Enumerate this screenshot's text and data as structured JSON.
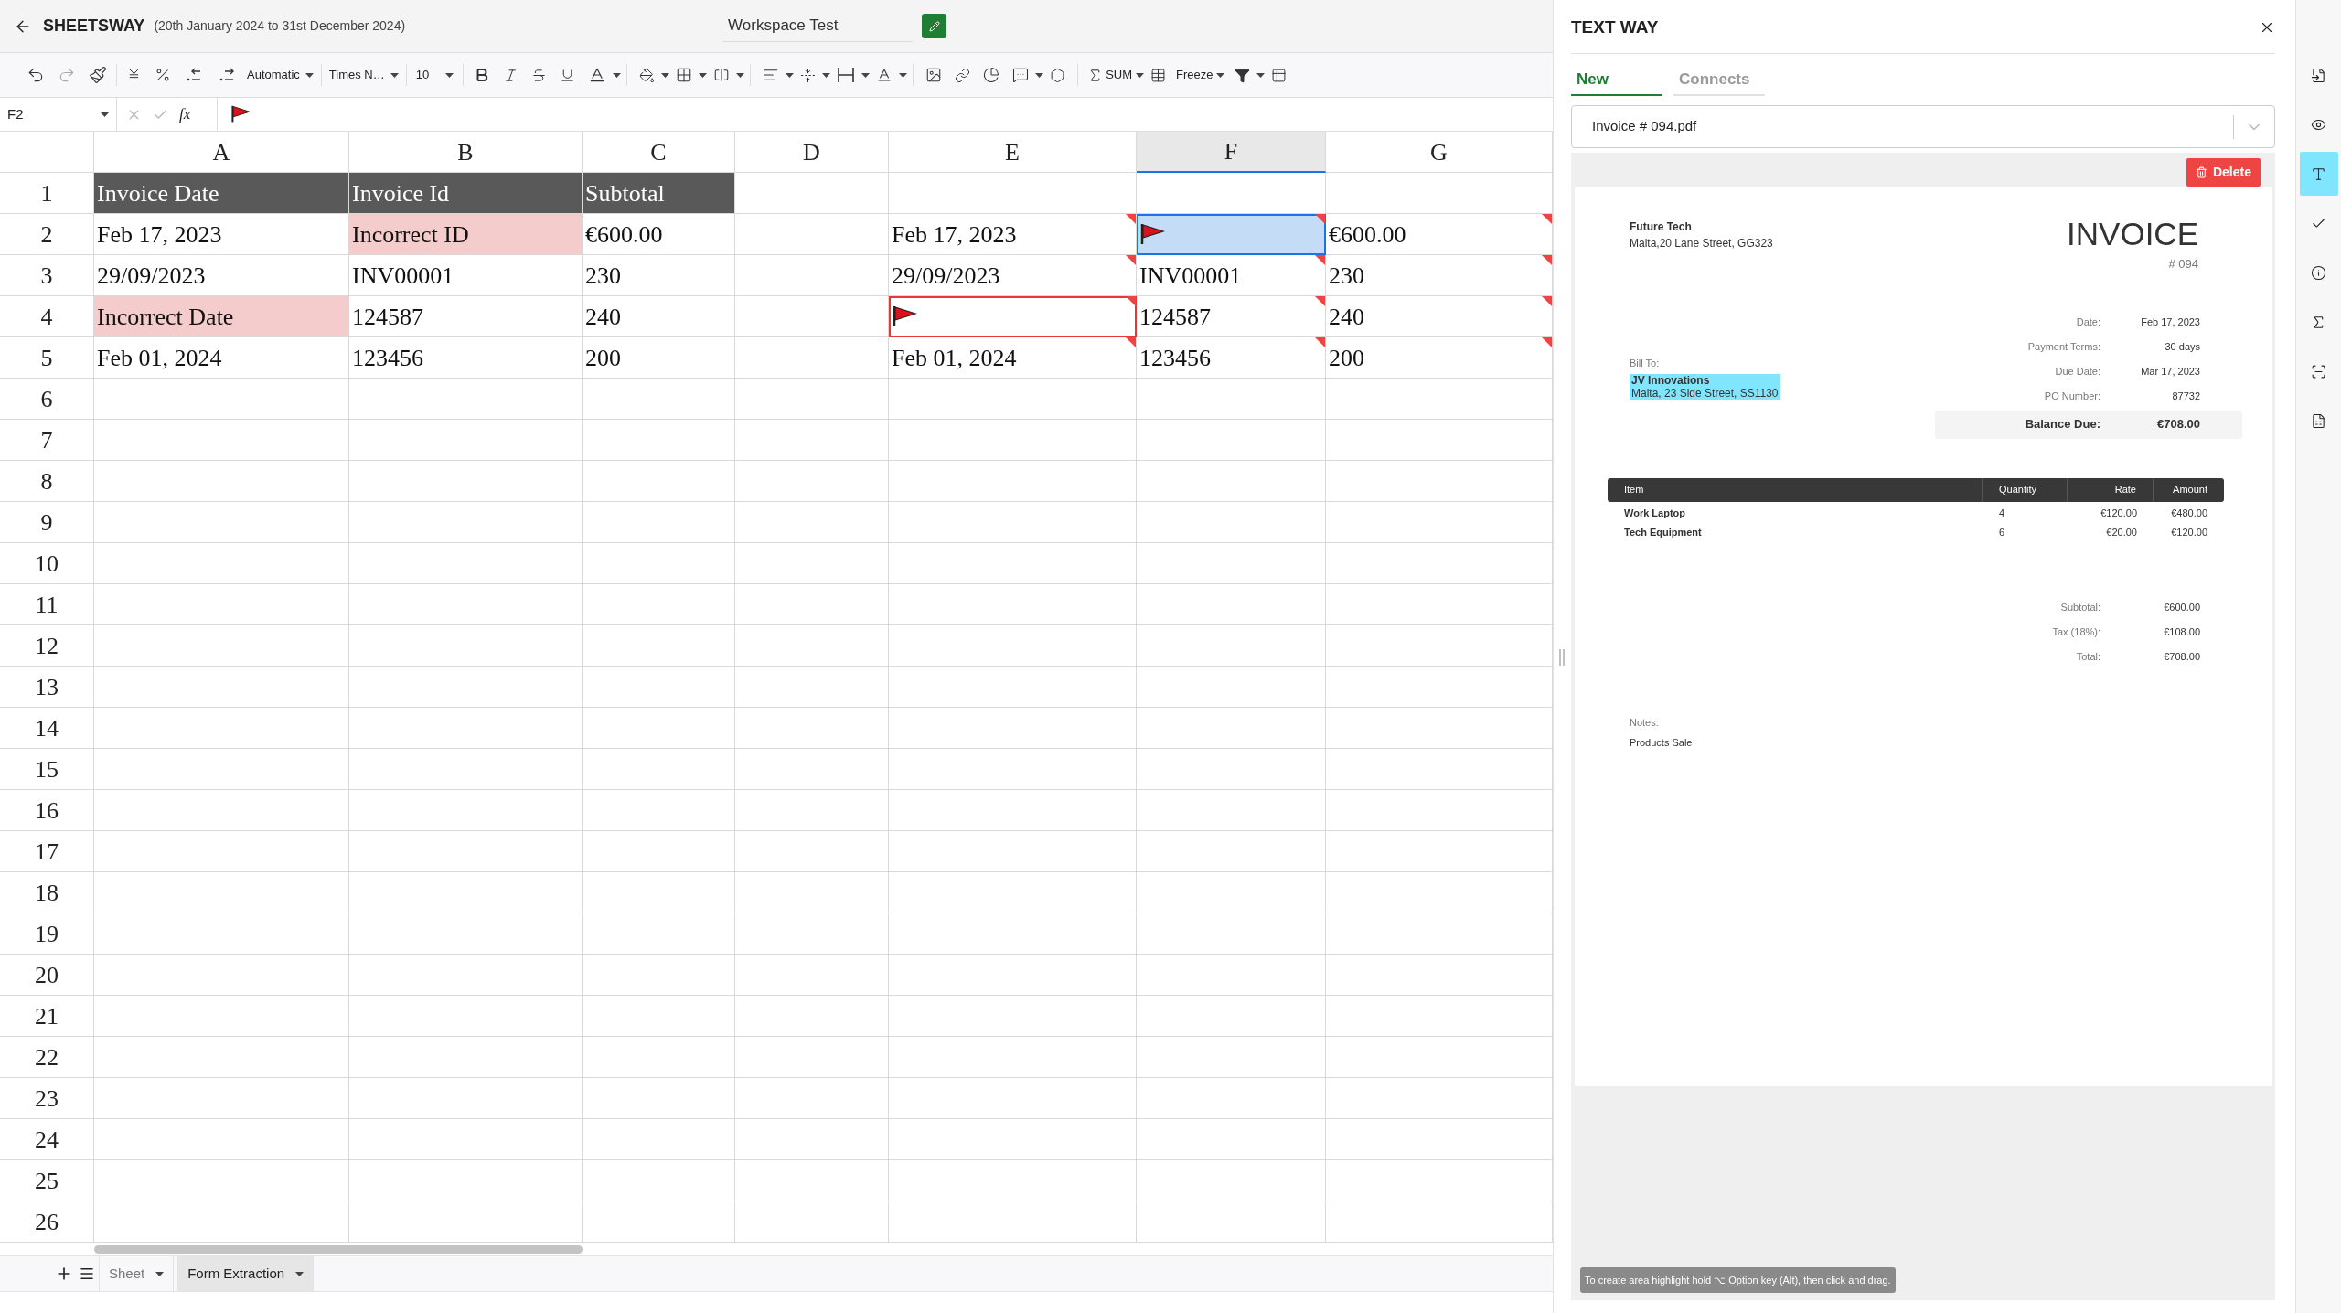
{
  "header": {
    "title": "SHEETSWAY",
    "subtitle": "(20th January 2024 to 31st December 2024)",
    "workspace": "Workspace Test"
  },
  "toolbar": {
    "number_format": "Automatic",
    "font": "Times N…",
    "font_size": "10",
    "sum": "SUM",
    "freeze": "Freeze"
  },
  "formula_bar": {
    "cell_ref": "F2",
    "fx": "fx"
  },
  "columns": [
    {
      "label": "A",
      "selected": false
    },
    {
      "label": "B",
      "selected": false
    },
    {
      "label": "C",
      "selected": false
    },
    {
      "label": "D",
      "selected": false
    },
    {
      "label": "E",
      "selected": false
    },
    {
      "label": "F",
      "selected": true
    },
    {
      "label": "G",
      "selected": false
    }
  ],
  "rows": [
    {
      "number": "1",
      "cells": [
        {
          "kind": "header",
          "text": "Invoice Date",
          "comment": false,
          "selected": false
        },
        {
          "kind": "header",
          "text": "Invoice Id",
          "comment": false,
          "selected": false
        },
        {
          "kind": "header",
          "text": "Subtotal",
          "comment": false,
          "selected": false
        },
        {
          "kind": "empty",
          "comment": false,
          "selected": false
        },
        {
          "kind": "empty",
          "comment": false,
          "selected": false
        },
        {
          "kind": "empty",
          "comment": false,
          "selected": false
        },
        {
          "kind": "empty",
          "comment": false,
          "selected": false
        }
      ]
    },
    {
      "number": "2",
      "cells": [
        {
          "kind": "text",
          "text": "Feb 17, 2023",
          "comment": false,
          "selected": false
        },
        {
          "kind": "error",
          "text": "Incorrect ID",
          "comment": false,
          "selected": false
        },
        {
          "kind": "text",
          "text": "€600.00",
          "comment": false,
          "selected": false
        },
        {
          "kind": "empty",
          "comment": false,
          "selected": false
        },
        {
          "kind": "text",
          "text": "Feb 17, 2023",
          "comment": true,
          "selected": false
        },
        {
          "kind": "flag",
          "comment": true,
          "selected": true
        },
        {
          "kind": "text",
          "text": "€600.00",
          "comment": true,
          "selected": false
        }
      ]
    },
    {
      "number": "3",
      "cells": [
        {
          "kind": "text",
          "text": "29/09/2023",
          "comment": false,
          "selected": false
        },
        {
          "kind": "text",
          "text": "INV00001",
          "comment": false,
          "selected": false
        },
        {
          "kind": "text",
          "text": "230",
          "comment": false,
          "selected": false
        },
        {
          "kind": "empty",
          "comment": false,
          "selected": false
        },
        {
          "kind": "text",
          "text": "29/09/2023",
          "comment": true,
          "selected": false
        },
        {
          "kind": "text",
          "text": "INV00001",
          "comment": true,
          "selected": false
        },
        {
          "kind": "text",
          "text": "230",
          "comment": true,
          "selected": false
        }
      ]
    },
    {
      "number": "4",
      "cells": [
        {
          "kind": "error",
          "text": "Incorrect Date",
          "comment": false,
          "selected": false
        },
        {
          "kind": "text",
          "text": "124587",
          "comment": false,
          "selected": false
        },
        {
          "kind": "text",
          "text": "240",
          "comment": false,
          "selected": false
        },
        {
          "kind": "empty",
          "comment": false,
          "selected": false
        },
        {
          "kind": "error-flag",
          "comment": true,
          "selected": false
        },
        {
          "kind": "text",
          "text": "124587",
          "comment": true,
          "selected": false
        },
        {
          "kind": "text",
          "text": "240",
          "comment": true,
          "selected": false
        }
      ]
    },
    {
      "number": "5",
      "cells": [
        {
          "kind": "text",
          "text": "Feb 01, 2024",
          "comment": false,
          "selected": false
        },
        {
          "kind": "text",
          "text": "123456",
          "comment": false,
          "selected": false
        },
        {
          "kind": "text",
          "text": "200",
          "comment": false,
          "selected": false
        },
        {
          "kind": "empty",
          "comment": false,
          "selected": false
        },
        {
          "kind": "text",
          "text": "Feb 01, 2024",
          "comment": true,
          "selected": false
        },
        {
          "kind": "text",
          "text": "123456",
          "comment": true,
          "selected": false
        },
        {
          "kind": "text",
          "text": "200",
          "comment": true,
          "selected": false
        }
      ]
    },
    {
      "number": "6"
    },
    {
      "number": "7"
    },
    {
      "number": "8"
    },
    {
      "number": "9"
    },
    {
      "number": "10"
    },
    {
      "number": "11"
    },
    {
      "number": "12"
    },
    {
      "number": "13"
    },
    {
      "number": "14"
    },
    {
      "number": "15"
    },
    {
      "number": "16"
    },
    {
      "number": "17"
    },
    {
      "number": "18"
    },
    {
      "number": "19"
    },
    {
      "number": "20"
    },
    {
      "number": "21"
    },
    {
      "number": "22"
    },
    {
      "number": "23"
    },
    {
      "number": "24"
    },
    {
      "number": "25"
    },
    {
      "number": "26"
    }
  ],
  "sheet_tabs": [
    {
      "label": "Sheet",
      "selected": false
    },
    {
      "label": "Form Extraction",
      "selected": true
    }
  ],
  "panel": {
    "title": "TEXT WAY",
    "tabs": [
      {
        "label": "New",
        "selected": true
      },
      {
        "label": "Connects",
        "selected": false
      }
    ],
    "file": "Invoice # 094.pdf",
    "delete": "Delete",
    "hint": "To create area highlight hold ⌥ Option key (Alt), then click and drag."
  },
  "invoice": {
    "from_name": "Future Tech",
    "from_address": "Malta,20 Lane Street, GG323",
    "title": "INVOICE",
    "number": "# 094",
    "bill_to_label": "Bill To:",
    "bill_to_name": "JV Innovations",
    "bill_to_address": "Malta, 23 Side Street, SS1130",
    "bill_to_highlighted": true,
    "details": [
      {
        "label": "Date:",
        "value": "Feb 17, 2023"
      },
      {
        "label": "Payment Terms:",
        "value": "30 days"
      },
      {
        "label": "Due Date:",
        "value": "Mar 17, 2023"
      },
      {
        "label": "PO Number:",
        "value": "87732"
      }
    ],
    "balance": {
      "label": "Balance Due:",
      "value": "€708.00"
    },
    "columns": [
      "Item",
      "Quantity",
      "Rate",
      "Amount"
    ],
    "items": [
      {
        "item": "Work Laptop",
        "quantity": "4",
        "rate": "€120.00",
        "amount": "€480.00"
      },
      {
        "item": "Tech Equipment",
        "quantity": "6",
        "rate": "€20.00",
        "amount": "€120.00"
      }
    ],
    "totals": [
      {
        "label": "Subtotal:",
        "value": "€600.00"
      },
      {
        "label": "Tax (18%):",
        "value": "€108.00"
      },
      {
        "label": "Total:",
        "value": "€708.00"
      }
    ],
    "notes_label": "Notes:",
    "notes": "Products Sale"
  },
  "side_tools": [
    {
      "selected": false
    },
    {
      "selected": false
    },
    {
      "selected": true
    },
    {
      "selected": false
    },
    {
      "selected": false
    },
    {
      "selected": false
    },
    {
      "selected": false
    },
    {
      "selected": false
    }
  ]
}
